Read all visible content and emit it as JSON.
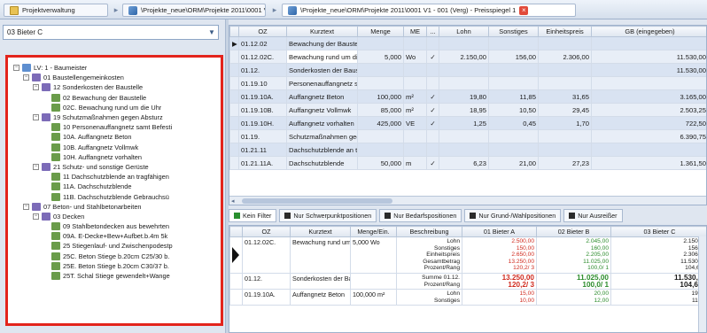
{
  "tabs": [
    {
      "label": "Projektverwaltung"
    },
    {
      "label": "\\Projekte_neue\\ORM\\Projekte 2011\\0001 V1"
    },
    {
      "label": "\\Projekte_neue\\ORM\\Projekte 2011\\0001 V1 - 001 (Verg) - Preisspiegel 1"
    }
  ],
  "bidder_select": {
    "value": "03 Bieter C"
  },
  "tree": [
    {
      "level": 0,
      "type": "lv",
      "exp": "−",
      "label": "LV: 1 - Baumeister"
    },
    {
      "level": 1,
      "type": "grp",
      "exp": "−",
      "label": "01 Baustellengemeinkosten"
    },
    {
      "level": 2,
      "type": "grp",
      "exp": "−",
      "label": "12 Sonderkosten der Baustelle"
    },
    {
      "level": 3,
      "type": "pos",
      "exp": "",
      "label": "02 Bewachung der Baustelle"
    },
    {
      "level": 3,
      "type": "pos",
      "exp": "",
      "label": "02C. Bewachung rund um die Uhr"
    },
    {
      "level": 2,
      "type": "grp",
      "exp": "−",
      "label": "19 Schutzmaßnahmen gegen Absturz"
    },
    {
      "level": 3,
      "type": "pos",
      "exp": "",
      "label": "10 Personenauffangnetz samt Befesti"
    },
    {
      "level": 3,
      "type": "pos",
      "exp": "",
      "label": "10A. Auffangnetz Beton"
    },
    {
      "level": 3,
      "type": "pos",
      "exp": "",
      "label": "10B. Auffangnetz Vollmwk"
    },
    {
      "level": 3,
      "type": "pos",
      "exp": "",
      "label": "10H. Auffangnetz vorhalten"
    },
    {
      "level": 2,
      "type": "grp",
      "exp": "−",
      "label": "21 Schutz- und sonstige Gerüste"
    },
    {
      "level": 3,
      "type": "pos",
      "exp": "",
      "label": "11 Dachschutzblende an tragfähigen"
    },
    {
      "level": 3,
      "type": "pos",
      "exp": "",
      "label": "11A. Dachschutzblende"
    },
    {
      "level": 3,
      "type": "pos",
      "exp": "",
      "label": "11B. Dachschutzblende Gebrauchsü"
    },
    {
      "level": 1,
      "type": "grp",
      "exp": "−",
      "label": "07 Beton- und Stahlbetonarbeiten"
    },
    {
      "level": 2,
      "type": "grp",
      "exp": "−",
      "label": "03 Decken"
    },
    {
      "level": 3,
      "type": "pos",
      "exp": "",
      "label": "09 Stahlbetondecken aus bewehrten"
    },
    {
      "level": 3,
      "type": "pos",
      "exp": "",
      "label": "09A. E-Decke+Bew+Aufbet.b.4m 5k"
    },
    {
      "level": 3,
      "type": "pos",
      "exp": "",
      "label": "25 Stiegenlauf- und Zwischenpodestp"
    },
    {
      "level": 3,
      "type": "pos",
      "exp": "",
      "label": "25C. Beton Stiege b.20cm C25/30 b."
    },
    {
      "level": 3,
      "type": "pos",
      "exp": "",
      "label": "25E. Beton Stiege b.20cm C30/37 b."
    },
    {
      "level": 3,
      "type": "pos",
      "exp": "",
      "label": "25T. Schal Stiege gewendelt+Wange"
    }
  ],
  "upper_grid": {
    "headers": [
      "",
      "OZ",
      "Kurztext",
      "Menge",
      "ME",
      "...",
      "Lohn",
      "Sonstiges",
      "Einheitspreis",
      "GB (eingegeben)"
    ],
    "rows": [
      {
        "marker": "▶",
        "oz": "01.12.02",
        "kurztext": "Bewachung der Baustelle",
        "menge": "",
        "me": "",
        "chk": "",
        "lohn": "",
        "sonst": "",
        "ep": "",
        "gb": ""
      },
      {
        "marker": "",
        "oz": "01.12.02C.",
        "kurztext": "Bewachung rund um die U",
        "menge": "5,000",
        "me": "Wo",
        "chk": "✓",
        "lohn": "2.150,00",
        "sonst": "156,00",
        "ep": "2.306,00",
        "gb": "11.530,00"
      },
      {
        "marker": "",
        "oz": "01.12.",
        "kurztext": "Sonderkosten der Baustelle",
        "menge": "",
        "me": "",
        "chk": "",
        "lohn": "",
        "sonst": "",
        "ep": "",
        "gb": "11.530,00"
      },
      {
        "marker": "",
        "oz": "01.19.10",
        "kurztext": "Personenauffangnetz samt",
        "menge": "",
        "me": "",
        "chk": "",
        "lohn": "",
        "sonst": "",
        "ep": "",
        "gb": ""
      },
      {
        "marker": "",
        "oz": "01.19.10A.",
        "kurztext": "Auffangnetz Beton",
        "menge": "100,000",
        "me": "m²",
        "chk": "✓",
        "lohn": "19,80",
        "sonst": "11,85",
        "ep": "31,65",
        "gb": "3.165,00"
      },
      {
        "marker": "",
        "oz": "01.19.10B.",
        "kurztext": "Auffangnetz Vollmwk",
        "menge": "85,000",
        "me": "m²",
        "chk": "✓",
        "lohn": "18,95",
        "sonst": "10,50",
        "ep": "29,45",
        "gb": "2.503,25"
      },
      {
        "marker": "",
        "oz": "01.19.10H.",
        "kurztext": "Auffangnetz vorhalten",
        "menge": "425,000",
        "me": "VE",
        "chk": "✓",
        "lohn": "1,25",
        "sonst": "0,45",
        "ep": "1,70",
        "gb": "722,50"
      },
      {
        "marker": "",
        "oz": "01.19.",
        "kurztext": "Schutzmaßnahmen gegen",
        "menge": "",
        "me": "",
        "chk": "",
        "lohn": "",
        "sonst": "",
        "ep": "",
        "gb": "6.390,75"
      },
      {
        "marker": "",
        "oz": "01.21.11",
        "kurztext": "Dachschutzblende an trag",
        "menge": "",
        "me": "",
        "chk": "",
        "lohn": "",
        "sonst": "",
        "ep": "",
        "gb": ""
      },
      {
        "marker": "",
        "oz": "01.21.11A.",
        "kurztext": "Dachschutzblende",
        "menge": "50,000",
        "me": "m",
        "chk": "✓",
        "lohn": "6,23",
        "sonst": "21,00",
        "ep": "27,23",
        "gb": "1.361,50"
      }
    ]
  },
  "filters": [
    {
      "label": "Kein Filter",
      "icon": "filter-none-icon"
    },
    {
      "label": "Nur Schwerpunktpositionen",
      "icon": "focus-icon"
    },
    {
      "label": "Nur Bedarfspositionen",
      "icon": "demand-icon"
    },
    {
      "label": "Nur Grund-/Wahlpositionen",
      "icon": "choice-icon"
    },
    {
      "label": "Nur Ausreißer",
      "icon": "outlier-icon"
    }
  ],
  "lower_grid": {
    "headers": [
      "",
      "OZ",
      "Kurztext",
      "Menge/Ein.",
      "Beschreibung",
      "01 Bieter A",
      "02 Bieter B",
      "03 Bieter C"
    ],
    "rows": [
      {
        "oz": "01.12.02C.",
        "kurztext": "Bewachung rund um die",
        "menge": "5,000 Wo",
        "desc": [
          "Lohn",
          "Sonstiges",
          "Einheitspreis",
          "Gesamtbetrag",
          "Prozent/Rang"
        ],
        "a": [
          "2.500,00",
          "150,00",
          "2.650,00",
          "13.250,00",
          "120,2/ 3"
        ],
        "b": [
          "2.045,00",
          "160,00",
          "2.205,00",
          "11.025,00",
          "100,0/ 1"
        ],
        "c": [
          "2.150,00",
          "156,00",
          "2.306,00",
          "11.530,00",
          "104,6/ 2"
        ]
      },
      {
        "oz": "01.12.",
        "kurztext": "Sonderkosten der Baust",
        "menge": "",
        "desc": [
          "Summe 01.12.",
          "Prozent/Rang"
        ],
        "a": [
          "13.250,00",
          "120,2/ 3"
        ],
        "b": [
          "11.025,00",
          "100,0/ 1"
        ],
        "c": [
          "11.530,00",
          "104,6/ 2"
        ]
      },
      {
        "oz": "01.19.10A.",
        "kurztext": "Auffangnetz Beton",
        "menge": "100,000 m²",
        "desc": [
          "Lohn",
          "Sonstiges"
        ],
        "a": [
          "15,00",
          "10,00"
        ],
        "b": [
          "20,00",
          "12,00"
        ],
        "c": [
          "19,80",
          "11,85"
        ]
      }
    ]
  },
  "colors": {
    "highlight_frame": "#e3241c",
    "winner_green": "#2c8c2c",
    "loser_red": "#d02b1f",
    "chrome_blue": "#3a74b8"
  }
}
